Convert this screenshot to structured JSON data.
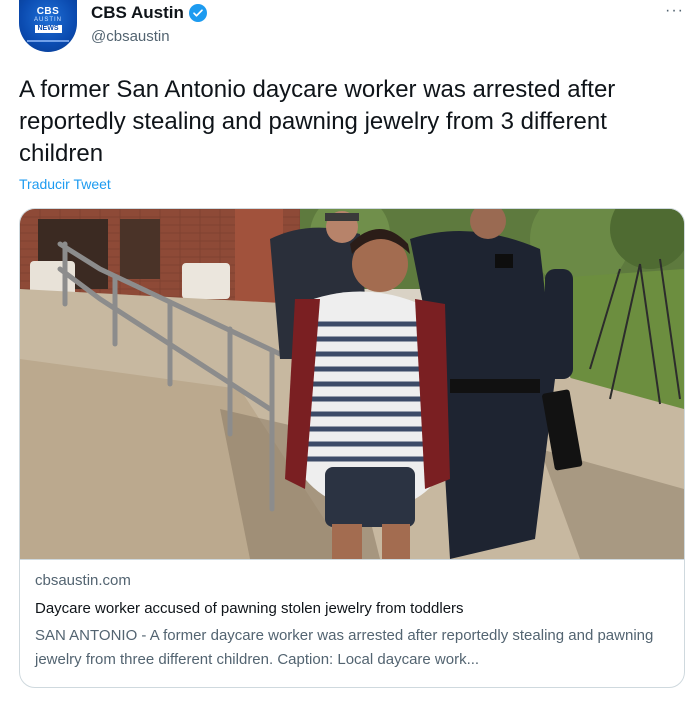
{
  "header": {
    "display_name": "CBS Austin",
    "handle": "@cbsaustin",
    "verified": true,
    "avatar": {
      "logo_line1": "CBS",
      "logo_line2": "AUSTIN",
      "logo_line3": "NEWS",
      "brand_color": "#0b4bb0"
    },
    "more_label": "···"
  },
  "tweet": {
    "text": "A former San Antonio daycare worker was arrested after reportedly stealing and pawning jewelry from 3 different children",
    "translate_label": "Traducir Tweet"
  },
  "card": {
    "domain": "cbsaustin.com",
    "title": "Daycare worker accused of pawning stolen jewelry from toddlers",
    "description": "SAN ANTONIO - A former daycare worker was arrested after reportedly stealing and pawning jewelry from three different children. Caption: Local daycare work...",
    "image_icon": "news-photo-arrest"
  },
  "colors": {
    "accent": "#1d9bf0",
    "secondary_text": "#536471",
    "border": "#cfd9de"
  }
}
